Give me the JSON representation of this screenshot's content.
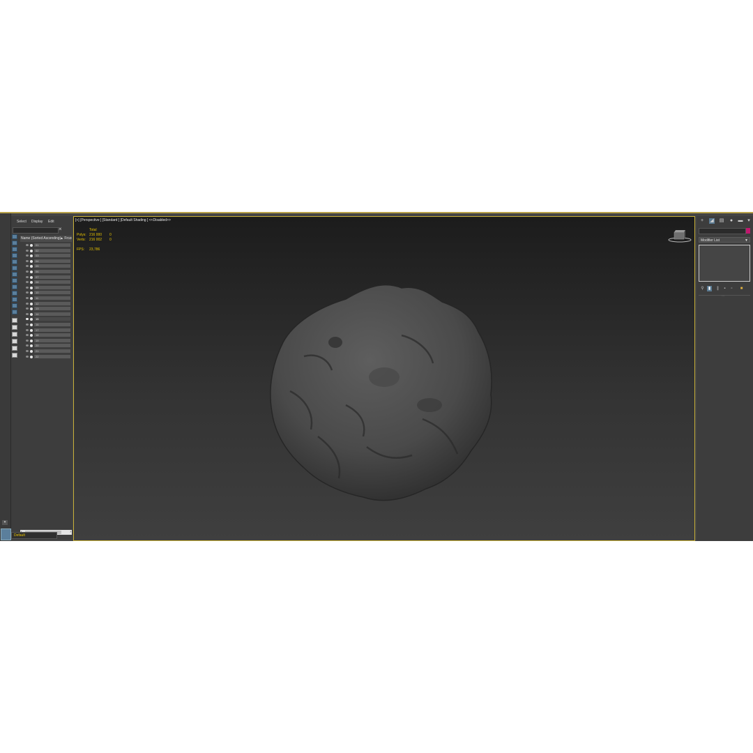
{
  "scene_explorer": {
    "menu": [
      "Select",
      "Display",
      "Edit"
    ],
    "columns": {
      "name": "Name (Sorted Ascending)",
      "frozen": "▲ Froze"
    },
    "items": [
      "01",
      "02",
      "03",
      "04",
      "05",
      "06",
      "07",
      "08",
      "09",
      "10",
      "11",
      "12",
      "13",
      "14",
      "15",
      "16",
      "17",
      "18",
      "19",
      "20",
      "21",
      "22"
    ],
    "layer": "Default"
  },
  "viewport": {
    "label": "[+] [Perspective ] [Standard ] [Default Shading ]  <<Disabled>>",
    "stats": {
      "total_label": "Total",
      "polys_label": "Polys:",
      "polys_total": "216 000",
      "polys_sel": "0",
      "verts_label": "Verts:",
      "verts_total": "216 002",
      "verts_sel": "0",
      "fps_label": "FPS:",
      "fps_value": "23,786"
    }
  },
  "command_panel": {
    "modifier_list": "Modifier List"
  },
  "colors": {
    "accent": "#c8b038",
    "swatch": "#c0186e",
    "stats_text": "#e6c200",
    "tool_blue": "#5b7f9c"
  },
  "icons": [
    "create-icon",
    "modify-icon",
    "hierarchy-icon",
    "motion-icon",
    "display-icon",
    "utilities-icon"
  ]
}
